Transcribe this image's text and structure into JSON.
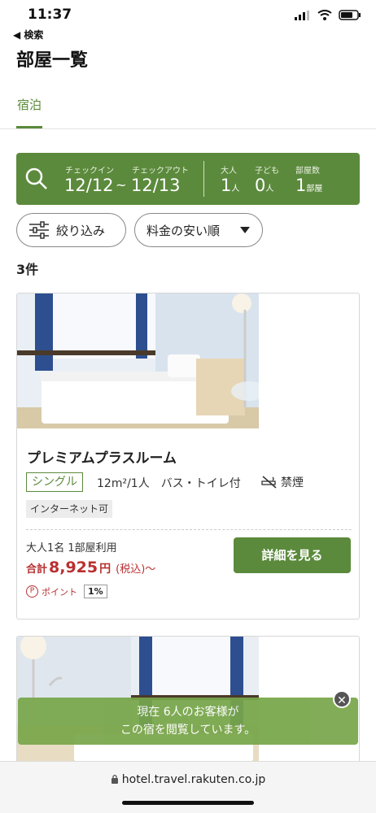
{
  "status_bar": {
    "time": "11:37",
    "back_label": "◀ 検索"
  },
  "page": {
    "title": "部屋一覧"
  },
  "tabs": [
    {
      "label": "宿泊",
      "active": true
    }
  ],
  "search": {
    "checkin_label": "チェックイン",
    "checkout_label": "チェックアウト",
    "checkin": "12/12",
    "separator": "~",
    "checkout": "12/13",
    "adults_label": "大人",
    "adults": "1",
    "adults_unit": "人",
    "children_label": "子ども",
    "children": "0",
    "children_unit": "人",
    "rooms_label": "部屋数",
    "rooms": "1",
    "rooms_unit": "部屋",
    "icon": "search-icon"
  },
  "filters": {
    "narrow_label": "絞り込み",
    "sort_label": "料金の安い順"
  },
  "results": {
    "count": "3件"
  },
  "rooms": [
    {
      "name": "プレミアムプラスルーム",
      "type": "シングル",
      "spec": "12m²/1人　バス・トイレ付",
      "smoking": "禁煙",
      "tag": "インターネット可",
      "occupancy": "大人1名 1部屋利用",
      "price_prefix": "合計",
      "price": "8,925",
      "price_yen": "円",
      "price_tax": "(税込)〜",
      "point_icon": "P",
      "point_label": "ポイント",
      "point_rate": "1%",
      "detail_button": "詳細を見る"
    }
  ],
  "toast": {
    "line1": "現在 6人のお客様が",
    "line2": "この宿を閲覧しています。",
    "close": "✕"
  },
  "browser": {
    "url": "hotel.travel.rakuten.co.jp"
  },
  "colors": {
    "accent": "#5b8a3c",
    "price": "#b93030",
    "toast": "#78a64a"
  }
}
